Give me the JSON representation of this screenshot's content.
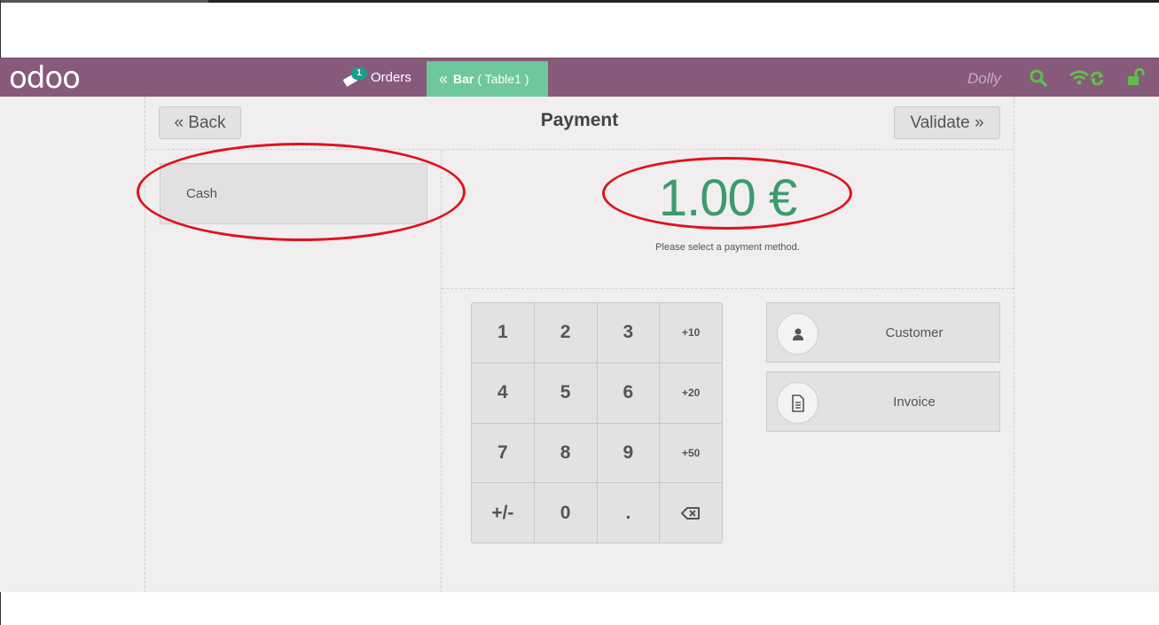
{
  "header": {
    "logo": "odoo",
    "orders_badge": "1",
    "orders_label": "Orders",
    "bar_label": "Bar",
    "table_label": "( Table1 )",
    "user": "Dolly",
    "icons": [
      "search-icon",
      "wifi-sync-icon",
      "unlock-icon"
    ],
    "accent_color": "#875a7b",
    "active_tab_color": "#6ec89b",
    "icon_color": "#5fbf49"
  },
  "payment": {
    "title": "Payment",
    "back_label": "« Back",
    "validate_label": "Validate »",
    "methods": [
      "Cash"
    ],
    "amount": "1.00 €",
    "amount_color": "#3d9a6f",
    "hint": "Please select a payment method."
  },
  "numpad": {
    "keys": [
      "1",
      "2",
      "3",
      "+10",
      "4",
      "5",
      "6",
      "+20",
      "7",
      "8",
      "9",
      "+50",
      "+/-",
      "0",
      ".",
      "⌫"
    ]
  },
  "actions": {
    "customer_label": "Customer",
    "invoice_label": "Invoice"
  },
  "annotations": {
    "color": "#e0121d"
  }
}
